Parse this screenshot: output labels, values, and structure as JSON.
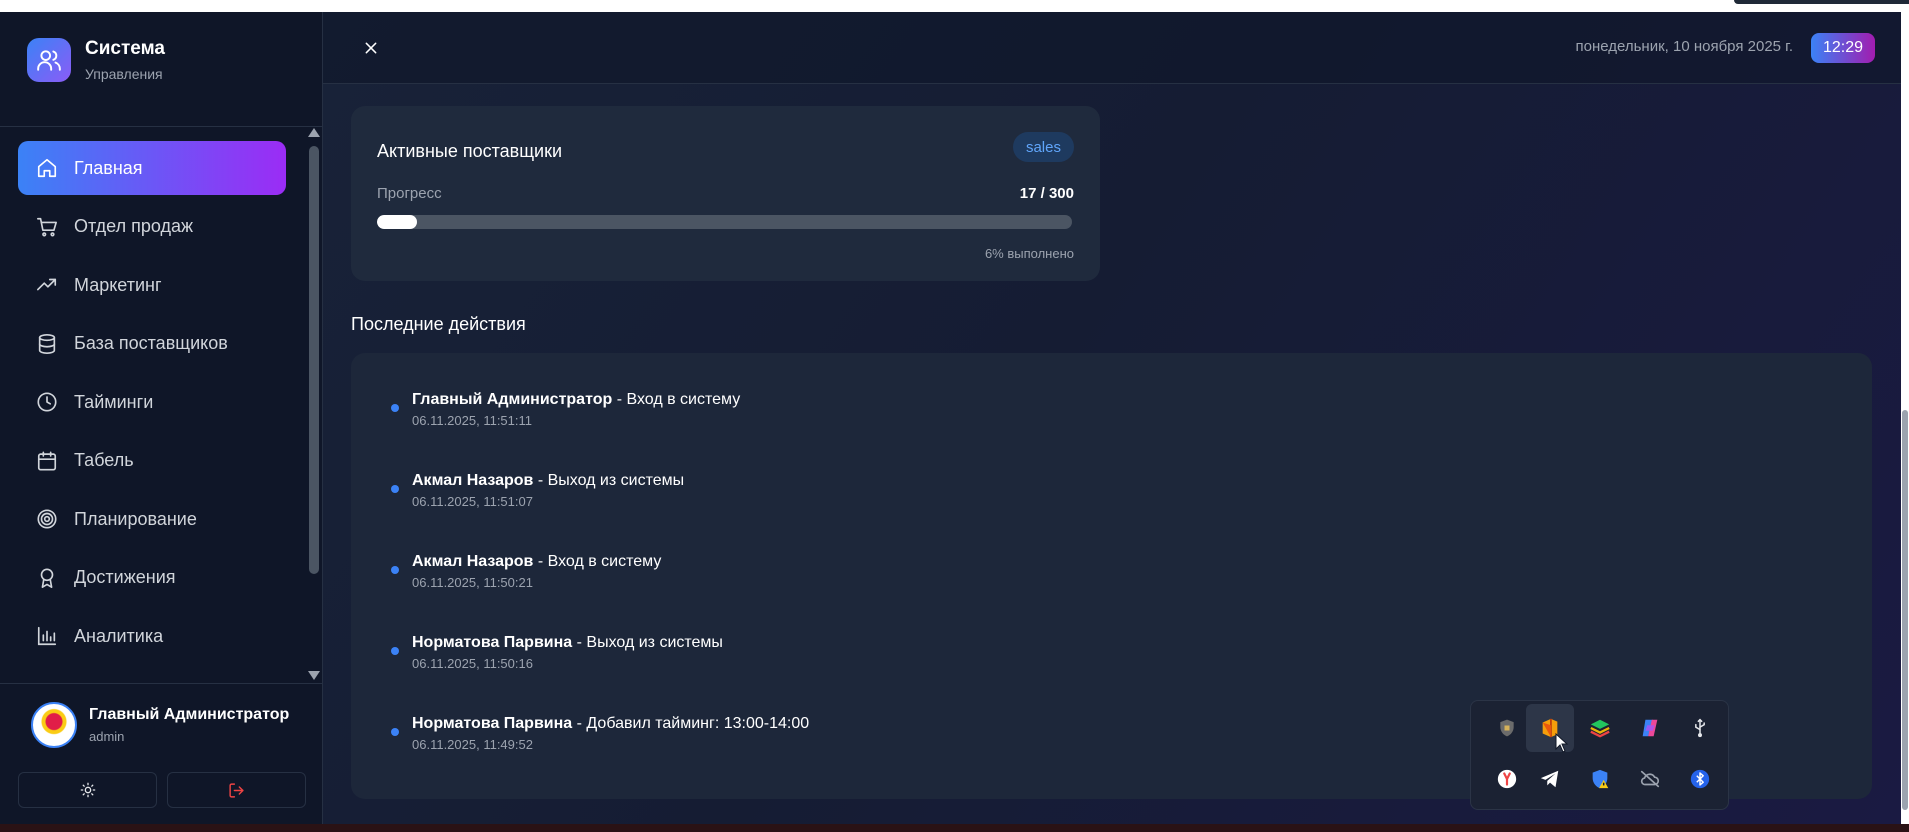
{
  "brand": {
    "title": "Система",
    "subtitle": "Управления"
  },
  "nav": [
    {
      "label": "Главная",
      "icon": "home-icon",
      "active": true
    },
    {
      "label": "Отдел продаж",
      "icon": "cart-icon",
      "active": false
    },
    {
      "label": "Маркетинг",
      "icon": "trending-up-icon",
      "active": false
    },
    {
      "label": "База поставщиков",
      "icon": "database-icon",
      "active": false
    },
    {
      "label": "Тайминги",
      "icon": "clock-icon",
      "active": false
    },
    {
      "label": "Табель",
      "icon": "calendar-icon",
      "active": false
    },
    {
      "label": "Планирование",
      "icon": "target-icon",
      "active": false
    },
    {
      "label": "Достижения",
      "icon": "award-icon",
      "active": false
    },
    {
      "label": "Аналитика",
      "icon": "bar-chart-icon",
      "active": false
    }
  ],
  "user": {
    "name": "Главный Администратор",
    "role": "admin"
  },
  "header": {
    "date": "понедельник, 10 ноября 2025 г.",
    "time": "12:29"
  },
  "progress_card": {
    "title": "Активные поставщики",
    "tag": "sales",
    "label": "Прогресс",
    "value_text": "17 / 300",
    "fraction": 0.057,
    "done_text": "6% выполнено"
  },
  "activity": {
    "title": "Последние действия",
    "items": [
      {
        "user": "Главный Администратор",
        "action": " - Вход в систему",
        "time": "06.11.2025, 11:51:11"
      },
      {
        "user": "Акмал Назаров",
        "action": " - Выход из системы",
        "time": "06.11.2025, 11:51:07"
      },
      {
        "user": "Акмал Назаров",
        "action": " - Вход в систему",
        "time": "06.11.2025, 11:50:21"
      },
      {
        "user": "Норматова Парвина",
        "action": " - Выход из системы",
        "time": "06.11.2025, 11:50:16"
      },
      {
        "user": "Норматова Парвина",
        "action": " - Добавил тайминг: 13:00-14:00",
        "time": "06.11.2025, 11:49:52"
      }
    ]
  },
  "tray_icons": [
    "shield-knight-icon",
    "office-icon",
    "layers-icon",
    "copilot-icon",
    "usb-icon",
    "yandex-icon",
    "telegram-icon",
    "defender-warning-icon",
    "cloud-off-icon",
    "bluetooth-icon"
  ],
  "colors": {
    "accent_start": "#3b82f6",
    "accent_end": "#9b2cf5",
    "sidebar_bg": "#0f1628",
    "card_bg": "#1f2a3d",
    "dot": "#3b82f6"
  }
}
